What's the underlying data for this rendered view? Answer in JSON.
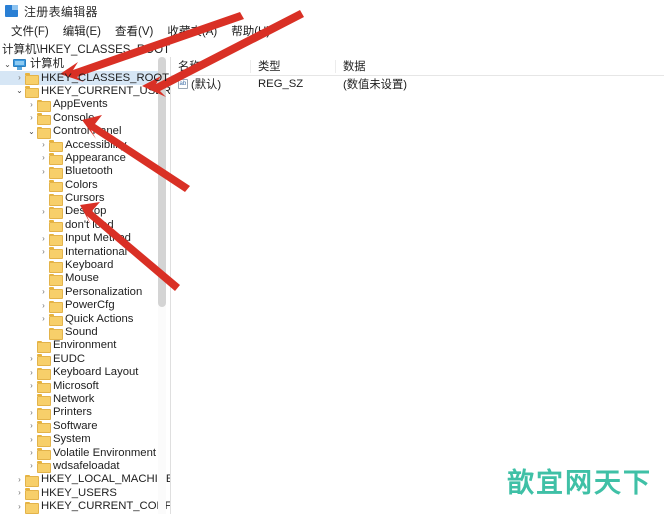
{
  "window": {
    "title": "注册表编辑器",
    "icon": "registry-editor-icon"
  },
  "menu": {
    "items": [
      {
        "label": "文件(F)"
      },
      {
        "label": "编辑(E)"
      },
      {
        "label": "查看(V)"
      },
      {
        "label": "收藏夹(A)"
      },
      {
        "label": "帮助(H)"
      }
    ]
  },
  "address": {
    "path": "计算机\\HKEY_CLASSES_ROOT"
  },
  "tree": {
    "nodes": [
      {
        "label": "计算机",
        "level": 0,
        "state": "open",
        "icon": "computer-icon",
        "selected": false
      },
      {
        "label": "HKEY_CLASSES_ROOT",
        "level": 1,
        "state": "closed",
        "icon": "folder-icon",
        "selected": true
      },
      {
        "label": "HKEY_CURRENT_USER",
        "level": 1,
        "state": "open",
        "icon": "folder-icon",
        "selected": false
      },
      {
        "label": "AppEvents",
        "level": 2,
        "state": "closed",
        "icon": "folder-icon",
        "selected": false
      },
      {
        "label": "Console",
        "level": 2,
        "state": "closed",
        "icon": "folder-icon",
        "selected": false
      },
      {
        "label": "Control Panel",
        "level": 2,
        "state": "open",
        "icon": "folder-icon",
        "selected": false
      },
      {
        "label": "Accessibility",
        "level": 3,
        "state": "closed",
        "icon": "folder-icon",
        "selected": false
      },
      {
        "label": "Appearance",
        "level": 3,
        "state": "closed",
        "icon": "folder-icon",
        "selected": false
      },
      {
        "label": "Bluetooth",
        "level": 3,
        "state": "closed",
        "icon": "folder-icon",
        "selected": false
      },
      {
        "label": "Colors",
        "level": 3,
        "state": "none",
        "icon": "folder-icon",
        "selected": false
      },
      {
        "label": "Cursors",
        "level": 3,
        "state": "none",
        "icon": "folder-icon",
        "selected": false
      },
      {
        "label": "Desktop",
        "level": 3,
        "state": "closed",
        "icon": "folder-icon",
        "selected": false
      },
      {
        "label": "don't load",
        "level": 3,
        "state": "none",
        "icon": "folder-icon",
        "selected": false
      },
      {
        "label": "Input Method",
        "level": 3,
        "state": "closed",
        "icon": "folder-icon",
        "selected": false
      },
      {
        "label": "International",
        "level": 3,
        "state": "closed",
        "icon": "folder-icon",
        "selected": false
      },
      {
        "label": "Keyboard",
        "level": 3,
        "state": "none",
        "icon": "folder-icon",
        "selected": false
      },
      {
        "label": "Mouse",
        "level": 3,
        "state": "none",
        "icon": "folder-icon",
        "selected": false
      },
      {
        "label": "Personalization",
        "level": 3,
        "state": "closed",
        "icon": "folder-icon",
        "selected": false
      },
      {
        "label": "PowerCfg",
        "level": 3,
        "state": "closed",
        "icon": "folder-icon",
        "selected": false
      },
      {
        "label": "Quick Actions",
        "level": 3,
        "state": "closed",
        "icon": "folder-icon",
        "selected": false
      },
      {
        "label": "Sound",
        "level": 3,
        "state": "none",
        "icon": "folder-icon",
        "selected": false
      },
      {
        "label": "Environment",
        "level": 2,
        "state": "none",
        "icon": "folder-icon",
        "selected": false
      },
      {
        "label": "EUDC",
        "level": 2,
        "state": "closed",
        "icon": "folder-icon",
        "selected": false
      },
      {
        "label": "Keyboard Layout",
        "level": 2,
        "state": "closed",
        "icon": "folder-icon",
        "selected": false
      },
      {
        "label": "Microsoft",
        "level": 2,
        "state": "closed",
        "icon": "folder-icon",
        "selected": false
      },
      {
        "label": "Network",
        "level": 2,
        "state": "none",
        "icon": "folder-icon",
        "selected": false
      },
      {
        "label": "Printers",
        "level": 2,
        "state": "closed",
        "icon": "folder-icon",
        "selected": false
      },
      {
        "label": "Software",
        "level": 2,
        "state": "closed",
        "icon": "folder-icon",
        "selected": false
      },
      {
        "label": "System",
        "level": 2,
        "state": "closed",
        "icon": "folder-icon",
        "selected": false
      },
      {
        "label": "Volatile Environment",
        "level": 2,
        "state": "closed",
        "icon": "folder-icon",
        "selected": false
      },
      {
        "label": "wdsafeloadat",
        "level": 2,
        "state": "closed",
        "icon": "folder-icon",
        "selected": false
      },
      {
        "label": "HKEY_LOCAL_MACHINE",
        "level": 1,
        "state": "closed",
        "icon": "folder-icon",
        "selected": false
      },
      {
        "label": "HKEY_USERS",
        "level": 1,
        "state": "closed",
        "icon": "folder-icon",
        "selected": false
      },
      {
        "label": "HKEY_CURRENT_CONFIG",
        "level": 1,
        "state": "closed",
        "icon": "folder-icon",
        "selected": false
      }
    ]
  },
  "list": {
    "columns": [
      "名称",
      "类型",
      "数据"
    ],
    "rows": [
      {
        "name": "(默认)",
        "type": "REG_SZ",
        "data": "(数值未设置)"
      }
    ]
  },
  "annotations": {
    "arrow_color": "#d93025",
    "arrows": [
      {
        "target": "HKEY_CLASSES_ROOT"
      },
      {
        "target": "HKEY_CURRENT_USER"
      },
      {
        "target": "Control Panel"
      },
      {
        "target": "Desktop"
      }
    ]
  },
  "watermark": {
    "text": "歆宜网天下",
    "color": "#3fc0a6"
  }
}
